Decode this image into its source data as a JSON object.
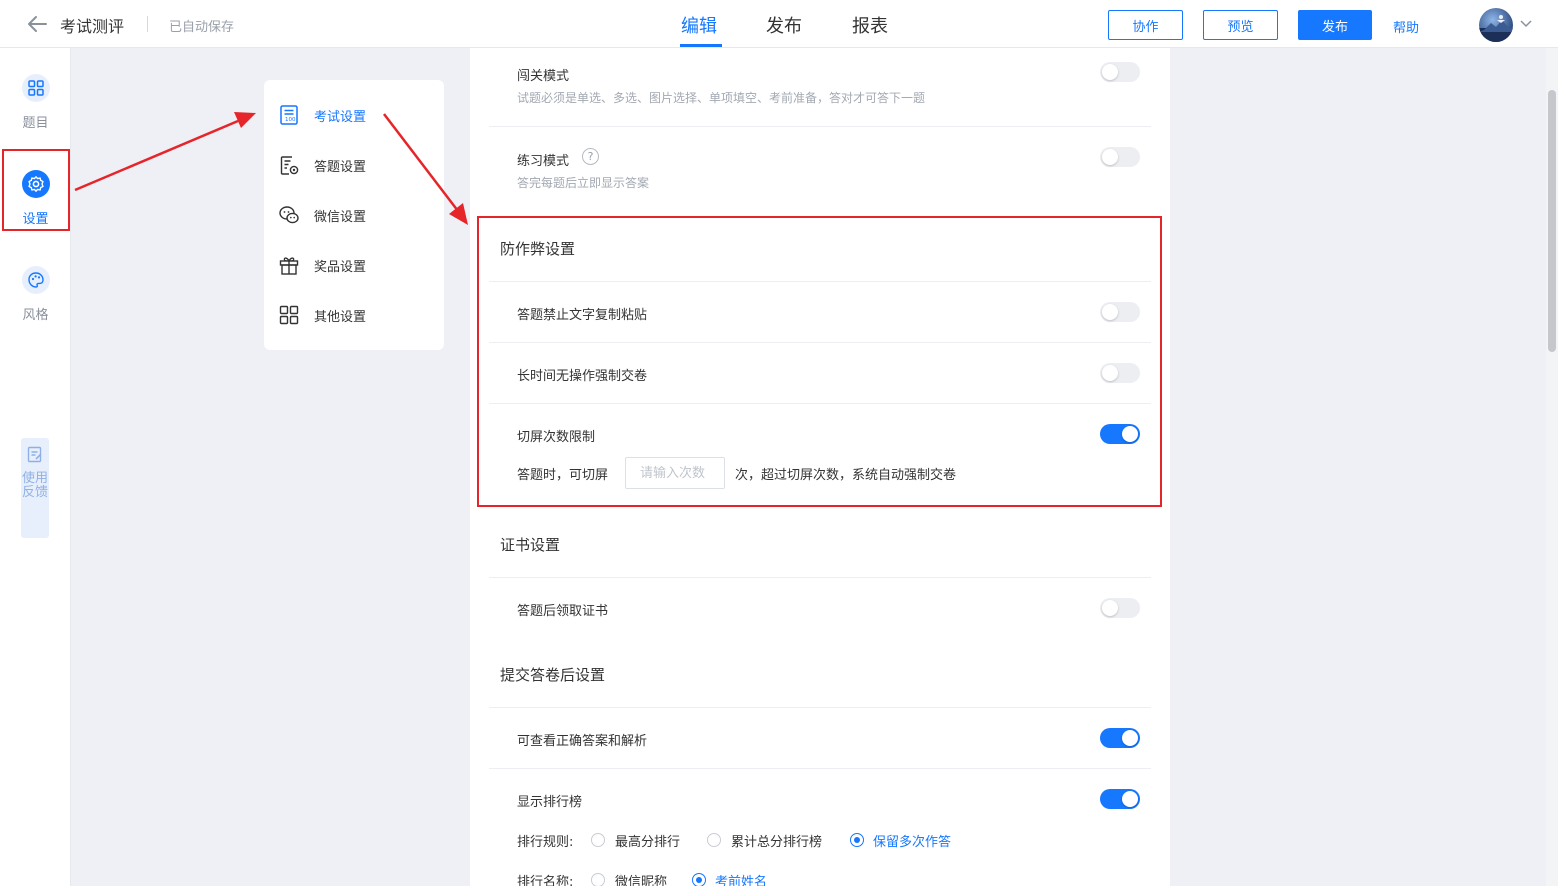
{
  "header": {
    "title": "考试测评",
    "autosave": "已自动保存",
    "tabs": [
      {
        "label": "编辑",
        "active": true
      },
      {
        "label": "发布",
        "active": false
      },
      {
        "label": "报表",
        "active": false
      }
    ],
    "buttons": {
      "collaborate": "协作",
      "preview": "预览",
      "publish": "发布",
      "help": "帮助"
    },
    "icons": {
      "back": "arrow-left-icon",
      "avatar_caret": "chevron-down-icon"
    }
  },
  "rail": {
    "items": [
      {
        "label": "题目",
        "icon": "grid-icon",
        "active": false
      },
      {
        "label": "设置",
        "icon": "gear-icon",
        "active": true
      },
      {
        "label": "风格",
        "icon": "palette-icon",
        "active": false
      }
    ],
    "feedback": "使用反馈"
  },
  "submenu": {
    "items": [
      {
        "label": "考试设置",
        "icon": "exam-sheet-icon",
        "active": true
      },
      {
        "label": "答题设置",
        "icon": "answer-settings-icon",
        "active": false
      },
      {
        "label": "微信设置",
        "icon": "wechat-icon",
        "active": false
      },
      {
        "label": "奖品设置",
        "icon": "gift-icon",
        "active": false
      },
      {
        "label": "其他设置",
        "icon": "apps-icon",
        "active": false
      }
    ]
  },
  "settings": {
    "level_mode": {
      "title": "闯关模式",
      "desc": "试题必须是单选、多选、图片选择、单项填空、考前准备，答对才可答下一题",
      "on": false
    },
    "practice_mode": {
      "title": "练习模式",
      "desc": "答完每题后立即显示答案",
      "help": "?",
      "on": false
    },
    "anti_cheat": {
      "title": "防作弊设置",
      "no_copy": {
        "title": "答题禁止文字复制粘贴",
        "on": false
      },
      "idle_submit": {
        "title": "长时间无操作强制交卷",
        "on": false
      },
      "switch_limit": {
        "title": "切屏次数限制",
        "on": true,
        "prefix": "答题时，可切屏",
        "placeholder": "请输入次数",
        "suffix": "次，超过切屏次数，系统自动强制交卷"
      }
    },
    "certificate": {
      "title": "证书设置",
      "after_answer": {
        "title": "答题后领取证书",
        "on": false
      }
    },
    "after_submit": {
      "title": "提交答卷后设置",
      "show_answer": {
        "title": "可查看正确答案和解析",
        "on": true
      },
      "leaderboard": {
        "title": "显示排行榜",
        "on": true,
        "rule_label": "排行规则:",
        "rules": [
          {
            "label": "最高分排行",
            "checked": false
          },
          {
            "label": "累计总分排行榜",
            "checked": false
          },
          {
            "label": "保留多次作答",
            "checked": true
          }
        ],
        "name_label": "排行名称:",
        "names": [
          {
            "label": "微信昵称",
            "checked": false
          },
          {
            "label": "考前姓名",
            "checked": true
          }
        ]
      }
    }
  },
  "colors": {
    "accent": "#1677ff",
    "annotation": "#e5252a",
    "background": "#eef0f5"
  }
}
